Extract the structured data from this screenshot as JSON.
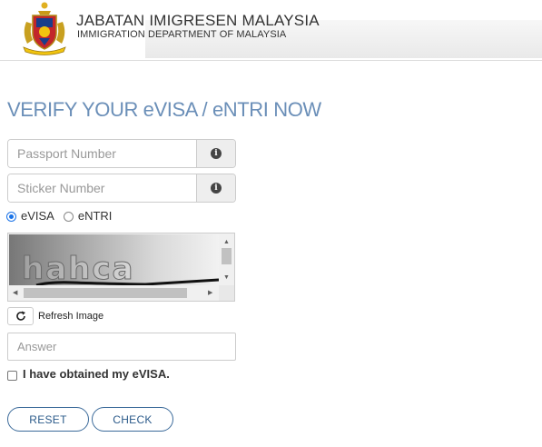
{
  "header": {
    "title": "JABATAN IMIGRESEN MALAYSIA",
    "subtitle": "IMMIGRATION DEPARTMENT OF MALAYSIA",
    "logo_icon": "imigresen-crest-icon"
  },
  "page": {
    "title": "VERIFY YOUR eVISA / eNTRI NOW"
  },
  "form": {
    "passport": {
      "value": "",
      "placeholder": "Passport Number",
      "addon_icon": "info-icon"
    },
    "sticker": {
      "value": "",
      "placeholder": "Sticker Number",
      "addon_icon": "info-icon"
    },
    "type_options": [
      {
        "label": "eVISA",
        "selected": true
      },
      {
        "label": "eNTRI",
        "selected": false
      }
    ],
    "captcha": {
      "text": "hahca"
    },
    "refresh": {
      "label": "Refresh Image",
      "icon": "refresh-icon"
    },
    "answer": {
      "value": "",
      "placeholder": "Answer"
    },
    "obtained": {
      "label": "I have obtained my eVISA.",
      "checked": false
    },
    "buttons": {
      "reset": "RESET",
      "check": "CHECK"
    }
  },
  "colors": {
    "heading": "#6b8fb8",
    "button_border": "#3b6a9a",
    "radio_selected": "#1a73e8"
  }
}
